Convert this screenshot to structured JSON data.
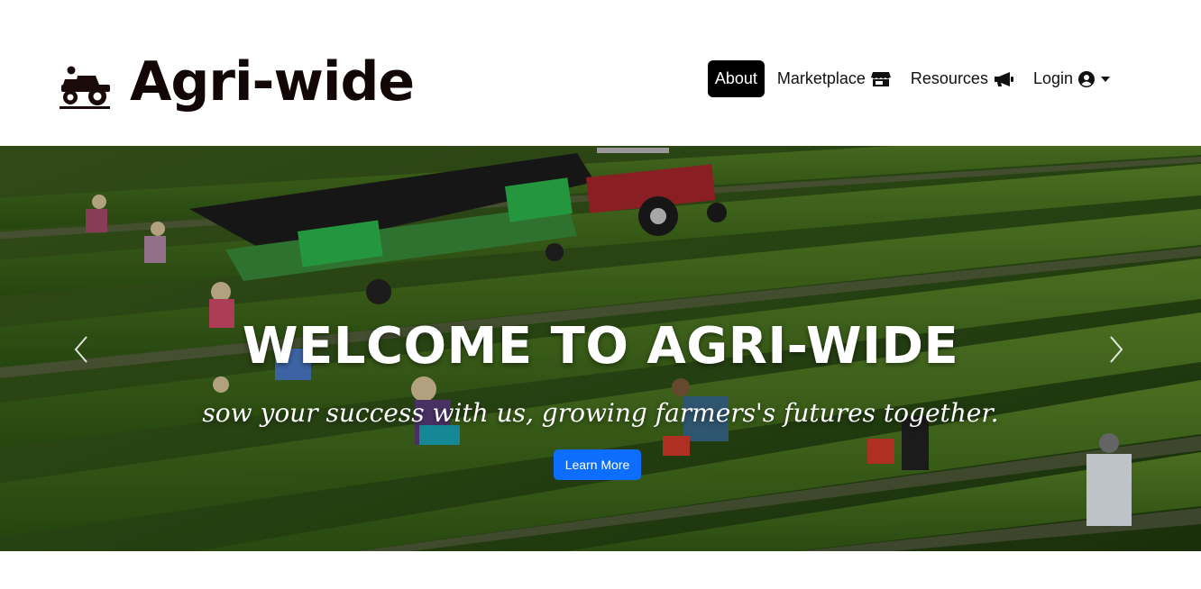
{
  "brand": {
    "name": "Agri-wide",
    "logo_icon": "tractor-farmer-icon"
  },
  "nav": {
    "items": [
      {
        "label": "About",
        "icon": null,
        "active": true
      },
      {
        "label": "Marketplace",
        "icon": "store-icon",
        "active": false
      },
      {
        "label": "Resources",
        "icon": "megaphone-icon",
        "active": false
      },
      {
        "label": "Login",
        "icon": "user-circle-icon",
        "dropdown": true,
        "active": false
      }
    ]
  },
  "hero": {
    "title": "WELCOME TO AGRI-WIDE",
    "subtitle": "sow your success with us, growing farmers's futures together.",
    "button_label": "Learn More",
    "prev_icon": "chevron-left-icon",
    "next_icon": "chevron-right-icon"
  },
  "colors": {
    "primary": "#0d6efd",
    "nav_active_bg": "#000000",
    "brand_text": "#120606"
  }
}
